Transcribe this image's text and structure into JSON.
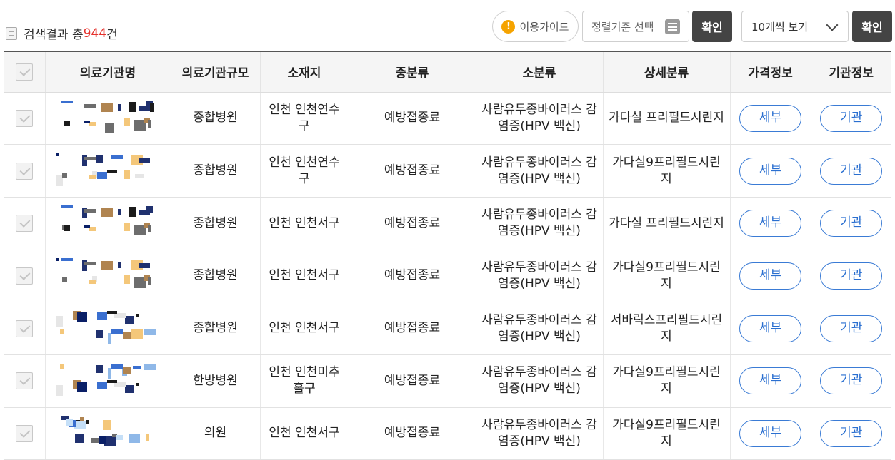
{
  "header": {
    "result_prefix": "검색결과 총",
    "result_count": "944",
    "result_suffix": "건",
    "guide_label": "이용가이드",
    "sort_placeholder": "정렬기준 선택",
    "confirm_label": "확인",
    "per_page_label": "10개씩 보기",
    "confirm2_label": "확인"
  },
  "table": {
    "columns": [
      "의료기관명",
      "의료기관규모",
      "소재지",
      "중분류",
      "소분류",
      "상세분류",
      "가격정보",
      "기관정보"
    ],
    "detail_label": "세부",
    "org_label": "기관",
    "rows": [
      {
        "size": "종합병원",
        "location": "인천 인천연수구",
        "mid": "예방접종료",
        "sub": "사람유두종바이러스 감염증(HPV 백신)",
        "detail": "가다실 프리필드시린지"
      },
      {
        "size": "종합병원",
        "location": "인천 인천연수구",
        "mid": "예방접종료",
        "sub": "사람유두종바이러스 감염증(HPV 백신)",
        "detail": "가다실9프리필드시린지"
      },
      {
        "size": "종합병원",
        "location": "인천 인천서구",
        "mid": "예방접종료",
        "sub": "사람유두종바이러스 감염증(HPV 백신)",
        "detail": "가다실 프리필드시린지"
      },
      {
        "size": "종합병원",
        "location": "인천 인천서구",
        "mid": "예방접종료",
        "sub": "사람유두종바이러스 감염증(HPV 백신)",
        "detail": "가다실9프리필드시린지"
      },
      {
        "size": "종합병원",
        "location": "인천 인천서구",
        "mid": "예방접종료",
        "sub": "사람유두종바이러스 감염증(HPV 백신)",
        "detail": "서바릭스프리필드시린지"
      },
      {
        "size": "한방병원",
        "location": "인천 인천미추홀구",
        "mid": "예방접종료",
        "sub": "사람유두종바이러스 감염증(HPV 백신)",
        "detail": "가다실9프리필드시린지"
      },
      {
        "size": "의원",
        "location": "인천 인천서구",
        "mid": "예방접종료",
        "sub": "사람유두종바이러스 감염증(HPV 백신)",
        "detail": "가다실9프리필드시린지"
      }
    ]
  },
  "colors": {
    "accent_blue": "#3a7bd5",
    "count_red": "#e5322d",
    "dark_button": "#444444",
    "warning_orange": "#f5a300"
  },
  "icons": {
    "result": "document-icon",
    "guide": "warning-icon",
    "sort": "list-icon",
    "per_page": "chevron-down-icon"
  }
}
